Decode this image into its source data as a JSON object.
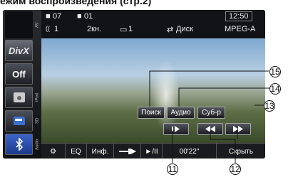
{
  "heading": "ежим воспроизведения (стр.2)",
  "top": {
    "folder": "07",
    "file": "01",
    "clock": "12:50",
    "audio_track": "1",
    "channels": "2кн.",
    "subtitle": "1",
    "repeat_mode": "Диск",
    "format": "MPEG-A"
  },
  "sidebar": {
    "av_label": "AV",
    "divx_label": "DivX",
    "off_label": "Off",
    "ipod_label": "iPod",
    "sd_label": "SD",
    "audio_label": "Audio"
  },
  "overlay": {
    "search": "Поиск",
    "audio": "Аудио",
    "subtitles": "Суб-р"
  },
  "bottom": {
    "eq": "EQ",
    "info": "Инф.",
    "time": "00'22\"",
    "hide": "Скрыть"
  },
  "callouts": {
    "c11": "11",
    "c12": "12",
    "c13": "13",
    "c14": "14",
    "c15": "15"
  }
}
